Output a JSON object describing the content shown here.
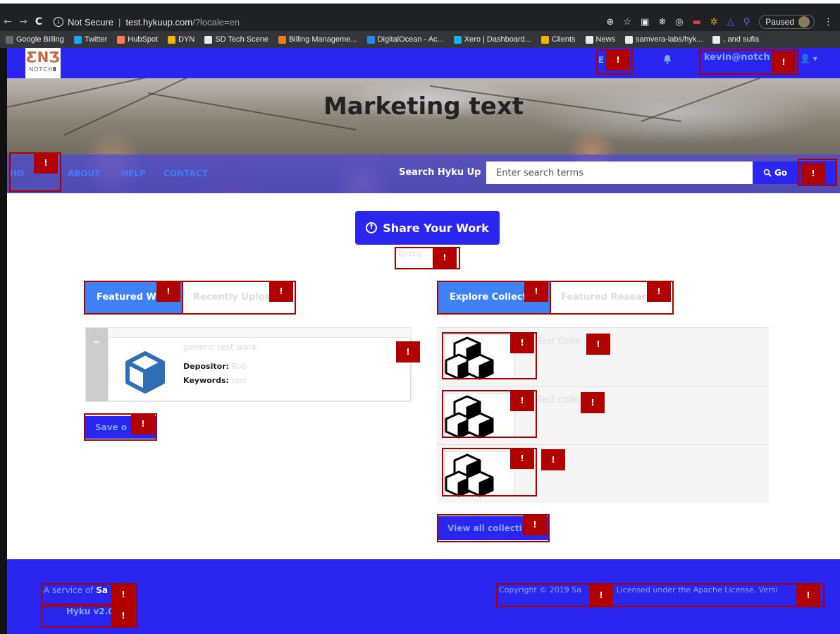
{
  "browser": {
    "url_prefix": "Not Secure",
    "host": "test.hykuup.com",
    "path": "/?locale=en",
    "paused_label": "Paused",
    "info_glyph": "i",
    "bookmarks": [
      {
        "label": "Google Billing",
        "color": "#6b6b6b"
      },
      {
        "label": "Twitter",
        "color": "#1da1f2"
      },
      {
        "label": "HubSpot",
        "color": "#ff7a59"
      },
      {
        "label": "DYN",
        "color": "#f4b400"
      },
      {
        "label": "SD Tech Scene",
        "color": "#e8eaed"
      },
      {
        "label": "Billing Manageme...",
        "color": "#e67e22"
      },
      {
        "label": "DigitalOcean - Ac...",
        "color": "#1f8ceb"
      },
      {
        "label": "Xero | Dashboard...",
        "color": "#13b5ea"
      },
      {
        "label": "Clients",
        "color": "#f4b400"
      },
      {
        "label": "News",
        "color": "#e8eaed"
      },
      {
        "label": "samvera-labs/hyk...",
        "color": "#e8eaed"
      },
      {
        "label": ", and sufia",
        "color": "#e8eaed"
      }
    ]
  },
  "header": {
    "logo_mark": "ƸNƷ",
    "logo_text_light": "NOTCH",
    "logo_text_bold": "8",
    "lang_label": "E",
    "user_email": "kevin@notch",
    "caret": "▾",
    "user_glyph": "👤"
  },
  "hero": {
    "title": "Marketing text",
    "nav": {
      "home": "HO",
      "about": "ABOUT",
      "help": "HELP",
      "contact": "CONTACT"
    },
    "search_label": "Search Hyku Up",
    "search_placeholder": "Enter search terms",
    "go_label": "Go"
  },
  "main": {
    "share_label": "Share Your Work",
    "terms_label": "Terms",
    "left_tabs": {
      "active": "Featured Wo",
      "inactive": "Recently Uploa"
    },
    "right_tabs": {
      "active": "Explore Collecti",
      "inactive": "Featured Resear"
    },
    "work": {
      "title": "generic test work",
      "depositor_label": "Depositor:",
      "depositor_value": "Rob",
      "keywords_label": "Keywords:",
      "keywords_value": "test"
    },
    "save_label": "Save o",
    "collections": [
      {
        "name": "Test Colle"
      },
      {
        "name": "Test colle"
      },
      {
        "name": ""
      }
    ],
    "view_all_label": "View all collecti"
  },
  "footer": {
    "service_prefix": "A service of",
    "service_name": "Sa",
    "version": "Hyku v2.0",
    "copyright": "Copyright © 2019 Sa",
    "license": "Licensed under the Apache License, Versi"
  },
  "alert_glyph": "!",
  "colors": {
    "brand_blue": "#2b25f0",
    "tab_blue": "#3f82f5",
    "alert_red": "#b00000",
    "link_blue": "#7aa9ff"
  }
}
